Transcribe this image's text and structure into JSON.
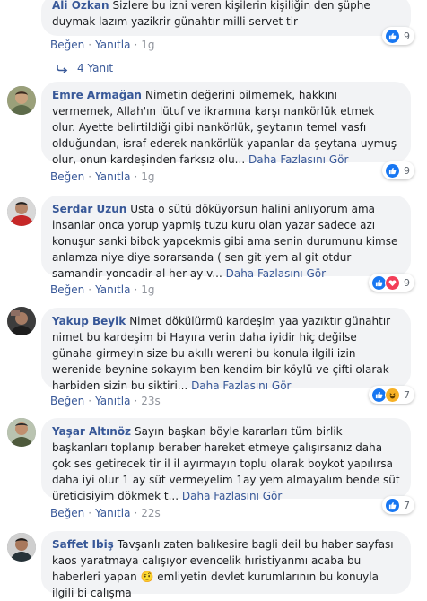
{
  "comments": [
    {
      "author": "Ali Ozkan",
      "text": "Sizlere bu izni veren kişilerin kişiliğin den şüphe duymak lazım yazikrir günahtır milli servet tir",
      "more": "",
      "like_label": "Beğen",
      "reply_label": "Yanıtla",
      "time": "1g",
      "reaction_count": "9",
      "reactions": [
        "like-icon"
      ],
      "replies_label": "4 Yanıt"
    },
    {
      "author": "Emre Armağan",
      "text": "Nimetin değerini bilmemek, hakkını vermemek, Allah'ın lütuf ve ikramına karşı nankörlük etmek olur. Ayette belirtildiği gibi nankörlük, şeytanın temel vasfı olduğundan, israf ederek nankörlük yapanlar da şeytana uymuş olur, onun kardeşinden farksız olu...",
      "more": "Daha Fazlasını Gör",
      "like_label": "Beğen",
      "reply_label": "Yanıtla",
      "time": "1g",
      "reaction_count": "9",
      "reactions": [
        "like-icon"
      ]
    },
    {
      "author": "Serdar Uzun",
      "text": "Usta o sütü döküyorsun halini anlıyorum ama insanlar onca yorup yapmiş tuzu kuru olan yazar sadece azı konuşur sanki bibok yapcekmis gibi ama senin durumunu kimse anlamza niye diye sorarsanda ( sen git yem al git otdur samandir yoncadir al her ay v...",
      "more": "Daha Fazlasını Gör",
      "like_label": "Beğen",
      "reply_label": "Yanıtla",
      "time": "1g",
      "reaction_count": "9",
      "reactions": [
        "like-icon",
        "love-icon"
      ]
    },
    {
      "author": "Yakup Beyik",
      "text": "Nimet dökülürmü kardeşim yaa yazıktır günahtır nimet bu kardeşim bi Hayıra verin daha iyidir hiç değilse günaha girmeyin size bu akıllı wereni bu konula ilgili izin werenide beynine sokayım ben kendim bir köylü ve çifti olarak harbiden sizin bu siktiri...",
      "more": "Daha Fazlasını Gör",
      "like_label": "Beğen",
      "reply_label": "Yanıtla",
      "time": "23s",
      "reaction_count": "7",
      "reactions": [
        "like-icon",
        "haha-icon"
      ]
    },
    {
      "author": "Yaşar Altınöz",
      "text": "Sayın başkan böyle kararları tüm birlik başkanları toplanıp beraber hareket etmeye çalışırsanız daha çok ses getirecek tir il il ayırmayın toplu olarak boykot yapılırsa daha iyi olur 1 ay süt vermeyelim 1ay yem almayalım bende süt üreticisiyim dökmek t...",
      "more": "Daha Fazlasını Gör",
      "like_label": "Beğen",
      "reply_label": "Yanıtla",
      "time": "22s",
      "reaction_count": "7",
      "reactions": [
        "like-icon"
      ]
    },
    {
      "author": "Saffet Ibiş",
      "text": "Tavşanlı zaten balıkesire bagli deil bu haber sayfası kaos yaratmaya calışıyor evencelik hıristiyanmı acaba bu haberleri yapan 🤨 emliyetin devlet kurumlarının bu konuyla ilgili bi calışma",
      "more": ""
    }
  ],
  "colors": {
    "link": "#385898",
    "muted": "#90949c",
    "bubble": "#f2f3f5",
    "like": "#1877f2",
    "love": "#f33e58",
    "haha": "#f7b125"
  }
}
